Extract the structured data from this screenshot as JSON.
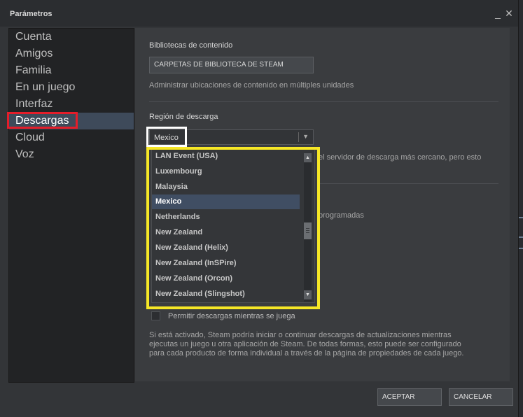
{
  "window": {
    "title": "Parámetros"
  },
  "sidebar": {
    "items": [
      {
        "label": "Cuenta"
      },
      {
        "label": "Amigos"
      },
      {
        "label": "Familia"
      },
      {
        "label": "En un juego"
      },
      {
        "label": "Interfaz"
      },
      {
        "label": "Descargas",
        "active": true
      },
      {
        "label": "Cloud"
      },
      {
        "label": "Voz"
      }
    ]
  },
  "content": {
    "library": {
      "heading": "Bibliotecas de contenido",
      "button": "CARPETAS DE BIBLIOTECA DE STEAM",
      "description": "Administrar ubicaciones de contenido en múltiples unidades"
    },
    "region": {
      "heading": "Región de descarga",
      "selected": "Mexico",
      "note": "el servidor de descarga más cercano, pero esto"
    },
    "partial_label": "programadas",
    "dropdown_options": [
      "LAN Event (USA)",
      "Luxembourg",
      "Malaysia",
      "Mexico",
      "Netherlands",
      "New Zealand",
      "New Zealand (Helix)",
      "New Zealand (InSPire)",
      "New Zealand (Orcon)",
      "New Zealand (Slingshot)"
    ],
    "allow_downloads": {
      "label": "Permitir descargas mientras se juega",
      "checked": false,
      "description": [
        "Si está activado, Steam podría iniciar o continuar descargas de actualizaciones mientras",
        "ejecutas un juego u otra aplicación de Steam. De todas formas, esto puede ser configurado",
        "para cada producto de forma individual a través de la página de propiedades de cada juego."
      ]
    }
  },
  "footer": {
    "accept": "ACEPTAR",
    "cancel": "CANCELAR"
  },
  "colors": {
    "highlight_red": "#e41d2a",
    "highlight_yellow": "#f6e726",
    "highlight_white": "#ffffff",
    "selection": "#404e63"
  }
}
